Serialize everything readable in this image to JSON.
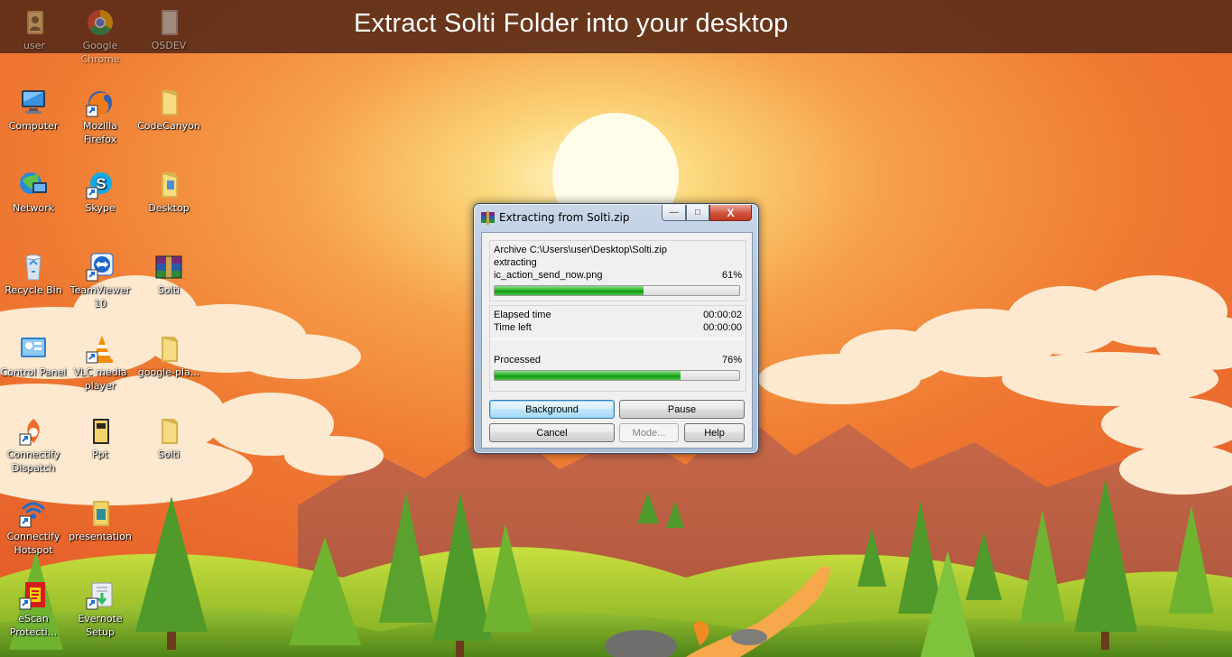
{
  "banner": {
    "title": "Extract Solti Folder into your desktop"
  },
  "desktop": {
    "icons": [
      {
        "id": "user",
        "label": "user",
        "icon": "user-folder-icon"
      },
      {
        "id": "google-chrome",
        "label": "Google Chrome",
        "icon": "chrome-icon"
      },
      {
        "id": "osdev",
        "label": "OSDEV",
        "icon": "folder-icon"
      },
      {
        "id": "computer",
        "label": "Computer",
        "icon": "computer-icon"
      },
      {
        "id": "mozilla-firefox",
        "label": "Mozilla Firefox",
        "icon": "firefox-icon"
      },
      {
        "id": "codecanyon",
        "label": "CodeCanyon",
        "icon": "folder-icon"
      },
      {
        "id": "network",
        "label": "Network",
        "icon": "network-icon"
      },
      {
        "id": "skype",
        "label": "Skype",
        "icon": "skype-icon"
      },
      {
        "id": "desktop",
        "label": "Desktop",
        "icon": "folder-icon"
      },
      {
        "id": "recycle-bin",
        "label": "Recycle Bin",
        "icon": "recycle-bin-icon"
      },
      {
        "id": "teamviewer",
        "label": "TeamViewer 10",
        "icon": "teamviewer-icon"
      },
      {
        "id": "solti-archive",
        "label": "Solti",
        "icon": "winrar-archive-icon"
      },
      {
        "id": "control-panel",
        "label": "Control Panel",
        "icon": "control-panel-icon"
      },
      {
        "id": "vlc",
        "label": "VLC media player",
        "icon": "vlc-icon"
      },
      {
        "id": "google-play",
        "label": "google-pla...",
        "icon": "folder-icon"
      },
      {
        "id": "connectify-dispatch",
        "label": "Connectify Dispatch",
        "icon": "connectify-dispatch-icon"
      },
      {
        "id": "ppt",
        "label": "Ppt",
        "icon": "folder-icon"
      },
      {
        "id": "solti-folder",
        "label": "Solti",
        "icon": "folder-icon"
      },
      {
        "id": "connectify-hotspot",
        "label": "Connectify Hotspot",
        "icon": "connectify-hotspot-icon"
      },
      {
        "id": "presentation",
        "label": "presentation",
        "icon": "folder-icon"
      },
      {
        "id": "escan",
        "label": "eScan Protecti...",
        "icon": "escan-icon"
      },
      {
        "id": "evernote",
        "label": "Evernote Setup",
        "icon": "evernote-setup-icon"
      }
    ]
  },
  "dialog": {
    "title": "Extracting from Solti.zip",
    "window_buttons": {
      "minimize": "—",
      "maximize": "□",
      "close": "X"
    },
    "archive_line": "Archive C:\\Users\\user\\Desktop\\Solti.zip",
    "action_line": "extracting",
    "current_file": "ic_action_send_now.png",
    "file_percent_text": "61%",
    "file_progress": 0.61,
    "elapsed_label": "Elapsed time",
    "elapsed_value": "00:00:02",
    "timeleft_label": "Time left",
    "timeleft_value": "00:00:00",
    "processed_label": "Processed",
    "processed_percent_text": "76%",
    "processed_progress": 0.76,
    "buttons": {
      "background": "Background",
      "pause": "Pause",
      "cancel": "Cancel",
      "mode": "Mode...",
      "help": "Help"
    }
  },
  "colors": {
    "sky_top": "#f0752d",
    "sun_glow": "#fbd77a",
    "banner_bg": "#5c2c18",
    "progress_green": "#2cb52c"
  }
}
